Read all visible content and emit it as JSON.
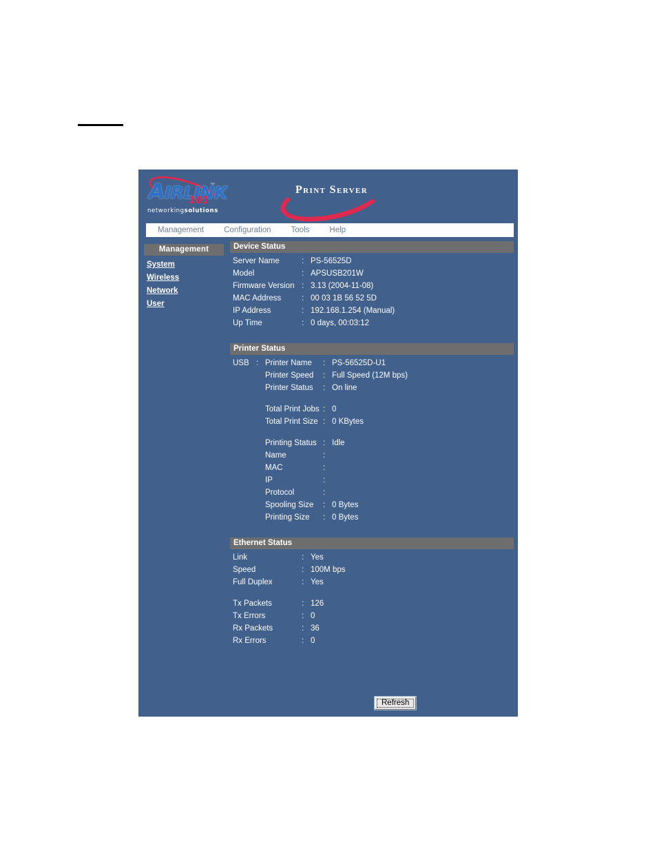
{
  "page": {
    "rule_visible": true
  },
  "branding": {
    "airlink_main": "IRLINK",
    "airlink_cap": "A",
    "airlink_tm": "™",
    "airlink_101": "101",
    "airlink_sub_light": "networking",
    "airlink_sub_bold": "solutions",
    "product_title": "Print Server",
    "accent_red": "#e0294e",
    "accent_blue": "#2f6fc4",
    "panel_blue": "#41608c",
    "bar_grey": "#6e6e6e"
  },
  "nav": {
    "items": [
      {
        "label": "Management",
        "name": "management"
      },
      {
        "label": "Configuration",
        "name": "configuration"
      },
      {
        "label": "Tools",
        "name": "tools"
      },
      {
        "label": "Help",
        "name": "help"
      }
    ]
  },
  "sidebar": {
    "header": "Management",
    "items": [
      {
        "label": "System"
      },
      {
        "label": "Wireless"
      },
      {
        "label": "Network"
      },
      {
        "label": "User"
      }
    ]
  },
  "device_status": {
    "title": "Device Status",
    "colon": ":",
    "rows": [
      {
        "label": "Server Name",
        "value": "PS-56525D"
      },
      {
        "label": "Model",
        "value": "APSUSB201W"
      },
      {
        "label": "Firmware Version",
        "value": "3.13 (2004-11-08)"
      },
      {
        "label": "MAC Address",
        "value": "00 03 1B 56 52 5D"
      },
      {
        "label": "IP Address",
        "value": "192.168.1.254 (Manual)"
      },
      {
        "label": "Up Time",
        "value": "0 days, 00:03:12"
      }
    ]
  },
  "printer_status": {
    "title": "Printer Status",
    "colon": ":",
    "port_label": "USB",
    "rows": [
      {
        "label": "Printer Name",
        "value": "PS-56525D-U1"
      },
      {
        "label": "Printer Speed",
        "value": "Full Speed (12M bps)"
      },
      {
        "label": "Printer Status",
        "value": "On line"
      }
    ],
    "totals": [
      {
        "label": "Total Print Jobs",
        "value": "0"
      },
      {
        "label": "Total Print Size",
        "value": "0 KBytes"
      }
    ],
    "printing": {
      "label": "Printing Status",
      "value": "Idle",
      "details": [
        {
          "label": "Name",
          "value": ""
        },
        {
          "label": "MAC",
          "value": ""
        },
        {
          "label": "IP",
          "value": ""
        },
        {
          "label": "Protocol",
          "value": ""
        },
        {
          "label": "Spooling Size",
          "value": "0 Bytes"
        },
        {
          "label": "Printing Size",
          "value": "0 Bytes"
        }
      ]
    }
  },
  "ethernet_status": {
    "title": "Ethernet Status",
    "colon": ":",
    "rows": [
      {
        "label": "Link",
        "value": "Yes"
      },
      {
        "label": "Speed",
        "value": "100M bps"
      },
      {
        "label": "Full Duplex",
        "value": "Yes"
      }
    ],
    "counters": [
      {
        "label": "Tx Packets",
        "value": "126"
      },
      {
        "label": "Tx Errors",
        "value": "0"
      },
      {
        "label": "Rx Packets",
        "value": "36"
      },
      {
        "label": "Rx Errors",
        "value": "0"
      }
    ]
  },
  "actions": {
    "refresh_label": "Refresh"
  }
}
